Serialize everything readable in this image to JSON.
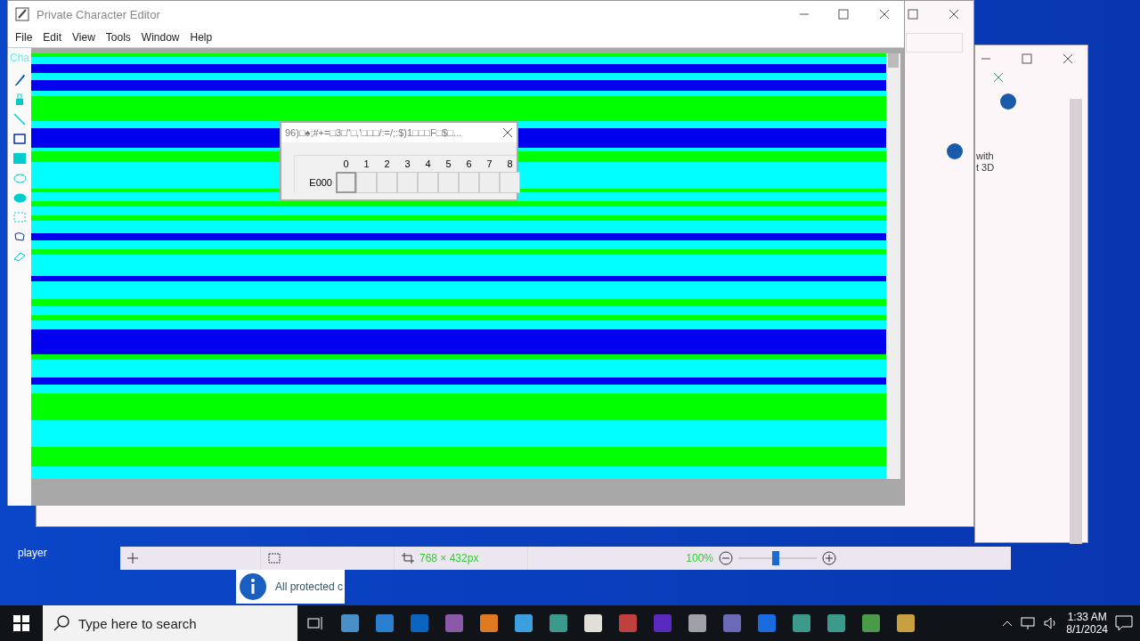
{
  "editor": {
    "title": "Private Character Editor",
    "menu": [
      "File",
      "Edit",
      "View",
      "Tools",
      "Window",
      "Help"
    ],
    "side_label": "Cha",
    "tools": [
      {
        "kind": "pencil"
      },
      {
        "kind": "brush"
      },
      {
        "kind": "line"
      },
      {
        "kind": "rect"
      },
      {
        "kind": "rect-filled"
      },
      {
        "kind": "ellipse"
      },
      {
        "kind": "ellipse-filled"
      },
      {
        "kind": "select-rect"
      },
      {
        "kind": "lasso"
      },
      {
        "kind": "eraser"
      }
    ]
  },
  "code_dialog": {
    "title": "96)□♠;#+=□3□\"□,'□□□/:=/;:$)1□□□F□$□...",
    "columns": [
      "0",
      "1",
      "2",
      "3",
      "4",
      "5",
      "6",
      "7",
      "8"
    ],
    "row_label": "E000",
    "cells": [
      {
        "selected": true
      },
      {
        "selected": false
      },
      {
        "selected": false
      },
      {
        "selected": false
      },
      {
        "selected": false
      },
      {
        "selected": false
      },
      {
        "selected": false
      },
      {
        "selected": false
      },
      {
        "selected": false
      }
    ]
  },
  "back_window": {
    "text_1": "with",
    "text_2": "t 3D"
  },
  "paint_status": {
    "size": "768 × 432px",
    "zoom": "100%",
    "zoom_slider": {
      "level": 0.48
    }
  },
  "notification": {
    "text": "All protected c"
  },
  "desktop_icon": {
    "label": "player"
  },
  "taskbar": {
    "search_placeholder": "Type here to search",
    "apps": [
      {
        "color": "#4a90c8"
      },
      {
        "color": "#2a7fd0"
      },
      {
        "color": "#0a64c0"
      },
      {
        "color": "#8a5aa8"
      },
      {
        "color": "#e07a20"
      },
      {
        "color": "#3aa0e0"
      },
      {
        "color": "#3c9a8a"
      },
      {
        "color": "#e0e0d8"
      },
      {
        "color": "#c04040"
      },
      {
        "color": "#5a2ac0"
      },
      {
        "color": "#a0a0a8"
      },
      {
        "color": "#6a6ab8"
      },
      {
        "color": "#1a6ae0"
      },
      {
        "color": "#3c9a8a"
      },
      {
        "color": "#3c9a8a"
      },
      {
        "color": "#4a9a4a"
      },
      {
        "color": "#c8a040"
      }
    ],
    "time": "1:33 AM",
    "date": "8/1/2024"
  }
}
